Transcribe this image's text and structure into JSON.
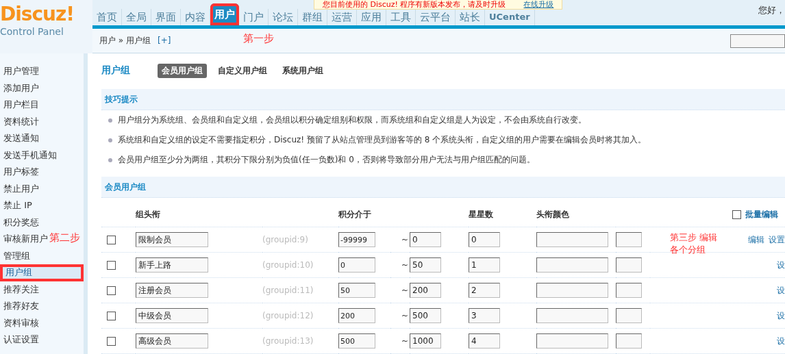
{
  "notice": {
    "text": "您目前使用的 Discuz! 程序有新版本发布，请及时升级",
    "link": "在线升级"
  },
  "logo": {
    "brand": "Discuz!",
    "subtitle": "Control Panel"
  },
  "greeting": "您好，",
  "nav": [
    {
      "label": "首页",
      "selected": false
    },
    {
      "label": "全局",
      "selected": false
    },
    {
      "label": "界面",
      "selected": false
    },
    {
      "label": "内容",
      "selected": false
    },
    {
      "label": "用户",
      "selected": true
    },
    {
      "label": "门户",
      "selected": false
    },
    {
      "label": "论坛",
      "selected": false
    },
    {
      "label": "群组",
      "selected": false
    },
    {
      "label": "运营",
      "selected": false
    },
    {
      "label": "应用",
      "selected": false
    },
    {
      "label": "工具",
      "selected": false
    },
    {
      "label": "云平台",
      "selected": false
    },
    {
      "label": "站长",
      "selected": false
    },
    {
      "label": "UCenter",
      "selected": false
    }
  ],
  "breadcrumb": {
    "path": "用户 » 用户组",
    "add": "[+]"
  },
  "sidebar": [
    {
      "label": "用户管理",
      "selected": false
    },
    {
      "label": "添加用户",
      "selected": false
    },
    {
      "label": "用户栏目",
      "selected": false
    },
    {
      "label": "资料统计",
      "selected": false
    },
    {
      "label": "发送通知",
      "selected": false
    },
    {
      "label": "发送手机通知",
      "selected": false
    },
    {
      "label": "用户标签",
      "selected": false
    },
    {
      "label": "禁止用户",
      "selected": false
    },
    {
      "label": "禁止 IP",
      "selected": false
    },
    {
      "label": "积分奖惩",
      "selected": false
    },
    {
      "label": "审核新用户",
      "selected": false
    },
    {
      "label": "管理组",
      "selected": false
    },
    {
      "label": "用户组",
      "selected": true
    },
    {
      "label": "推荐关注",
      "selected": false
    },
    {
      "label": "推荐好友",
      "selected": false
    },
    {
      "label": "资料审核",
      "selected": false
    },
    {
      "label": "认证设置",
      "selected": false
    }
  ],
  "page": {
    "title": "用户组",
    "tabs": [
      {
        "label": "会员用户组",
        "selected": true
      },
      {
        "label": "自定义用户组",
        "selected": false
      },
      {
        "label": "系统用户组",
        "selected": false
      }
    ]
  },
  "tips": {
    "title": "技巧提示",
    "items": [
      "用户组分为系统组、会员组和自定义组，会员组以积分确定组别和权限，而系统组和自定义组是人为设定，不会由系统自行改变。",
      "系统组和自定义组的设定不需要指定积分，Discuz! 预留了从站点管理员到游客等的 8 个系统头衔，自定义组的用户需要在编辑会员时将其加入。",
      "会员用户组至少分为两组，其积分下限分别为负值(任一负数)和 0，否则将导致部分用户无法与用户组匹配的问题。"
    ]
  },
  "member_groups": {
    "title": "会员用户组",
    "columns": [
      "组头衔",
      "积分介于",
      "星星数",
      "头衔颜色"
    ],
    "batch_edit": {
      "label": "批量编辑",
      "checked": false
    },
    "rows": [
      {
        "checked": false,
        "name": "限制会员",
        "groupid": "(groupid:9)",
        "min": "-99999",
        "separator": "~",
        "max": "0",
        "star_count": "0",
        "actions": [
          "编辑",
          "设置"
        ]
      },
      {
        "checked": false,
        "name": "新手上路",
        "groupid": "(groupid:10)",
        "min": "0",
        "separator": "~",
        "max": "50",
        "star_count": "1",
        "actions": [
          "设"
        ]
      },
      {
        "checked": false,
        "name": "注册会员",
        "groupid": "(groupid:11)",
        "min": "50",
        "separator": "~",
        "max": "200",
        "star_count": "2",
        "actions": [
          "设"
        ]
      },
      {
        "checked": false,
        "name": "中级会员",
        "groupid": "(groupid:12)",
        "min": "200",
        "separator": "~",
        "max": "500",
        "star_count": "3",
        "actions": [
          "设"
        ]
      },
      {
        "checked": false,
        "name": "高级会员",
        "groupid": "(groupid:13)",
        "min": "500",
        "separator": "~",
        "max": "1000",
        "star_count": "4",
        "actions": [
          "设"
        ]
      }
    ]
  },
  "annotations": [
    {
      "text": "第一步"
    },
    {
      "text": "第二步"
    },
    {
      "text": "第三步 编辑"
    },
    {
      "text": "各个分组"
    }
  ]
}
